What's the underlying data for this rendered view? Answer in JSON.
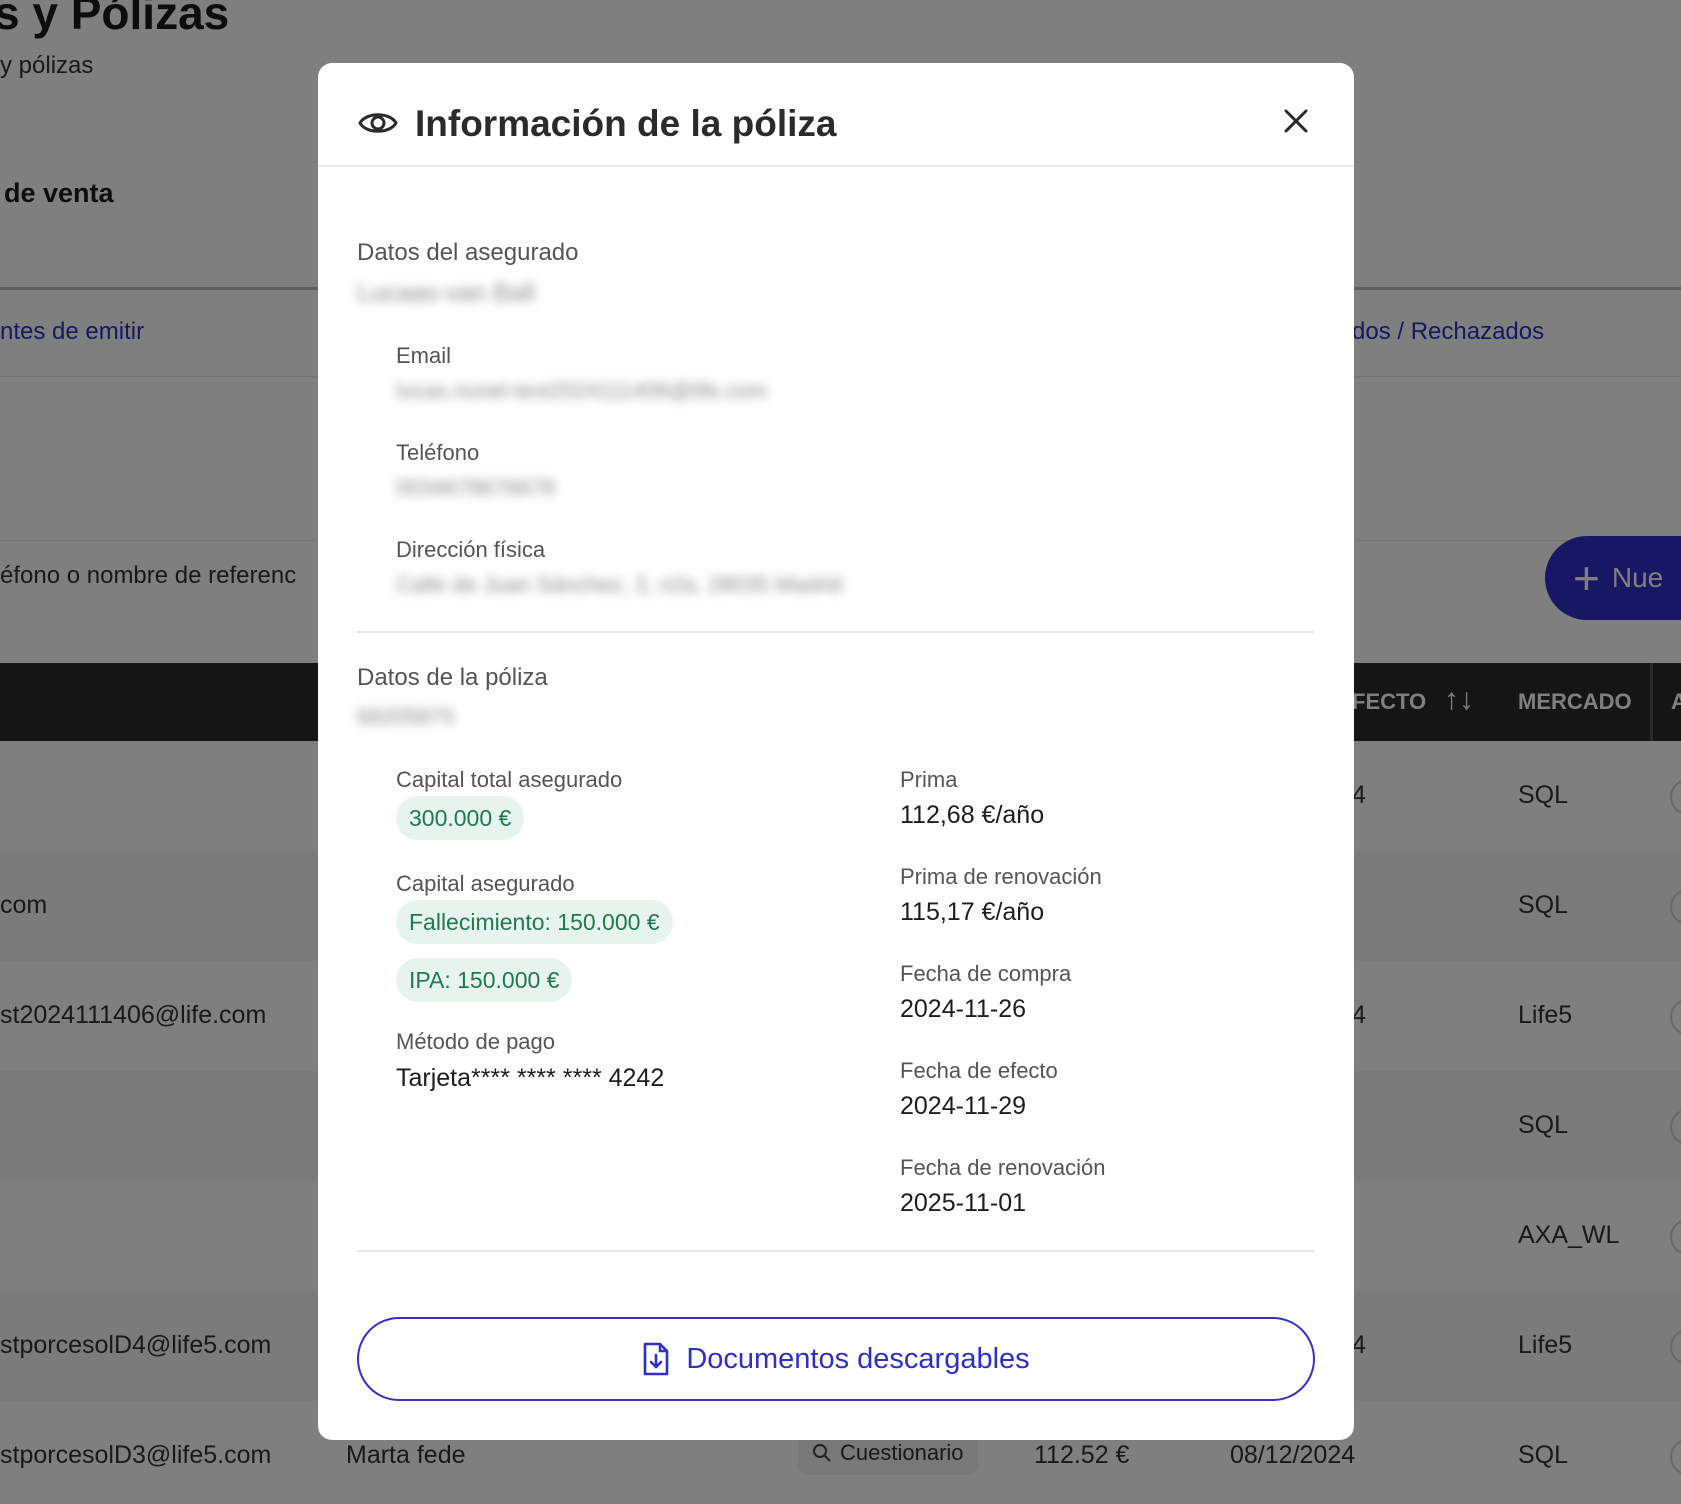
{
  "background": {
    "page_title": "s y Pólizas",
    "breadcrumb": "y pólizas",
    "section_title": "de venta",
    "tab_left": "ntes de emitir",
    "tab_right": "dos / Rechazados",
    "search_placeholder": "éfono o nombre de referenc",
    "new_button_label": "Nue",
    "table_headers": {
      "efecto": "FECTO",
      "sort_icon": "↑↓",
      "mercado": "MERCADO",
      "a": "A"
    },
    "rows": [
      {
        "email": "",
        "name": "",
        "status": "",
        "prima": "",
        "fecha": "",
        "fragment": "4",
        "mercado": "SQL"
      },
      {
        "email": "com",
        "name": "",
        "status": "",
        "prima": "",
        "fecha": "",
        "fragment": "",
        "mercado": "SQL"
      },
      {
        "email": "st2024111406@life.com",
        "name": "",
        "status": "",
        "prima": "",
        "fecha": "",
        "fragment": "4",
        "mercado": "Life5"
      },
      {
        "email": "",
        "name": "",
        "status": "",
        "prima": "",
        "fecha": "",
        "fragment": "",
        "mercado": "SQL"
      },
      {
        "email": "",
        "name": "",
        "status": "",
        "prima": "",
        "fecha": "",
        "fragment": "",
        "mercado": "AXA_WL"
      },
      {
        "email": "stporcesolD4@life5.com",
        "name": "",
        "status": "",
        "prima": "",
        "fecha": "",
        "fragment": "4",
        "mercado": "Life5"
      },
      {
        "email": "stporcesolD3@life5.com",
        "name": "Marta fede",
        "status": "Cuestionario",
        "prima": "112.52 €",
        "fecha": "08/12/2024",
        "fragment": "",
        "mercado": "SQL"
      }
    ]
  },
  "modal": {
    "title": "Información de la póliza",
    "icons": {
      "title": "eye-icon",
      "close": "close-icon",
      "docs": "download-document-icon"
    },
    "insured": {
      "section_title": "Datos del asegurado",
      "name_blurred": "Lucaas-van Ball",
      "email_label": "Email",
      "email_blurred": "lucas.nunel-test2024111406@life.com",
      "phone_label": "Teléfono",
      "phone_blurred": "0034678676678",
      "address_label": "Dirección física",
      "address_blurred": "Calle de Juan Sánchez, 3, n2a, 28035 Madrid"
    },
    "policy": {
      "section_title": "Datos de la póliza",
      "number_blurred": "68205875",
      "capital_total_label": "Capital total asegurado",
      "capital_total_value": "300.000 €",
      "capital_label": "Capital asegurado",
      "capital_fallecimiento": "Fallecimiento: 150.000 €",
      "capital_ipa": "IPA: 150.000 €",
      "payment_label": "Método de pago",
      "payment_value": "Tarjeta**** **** **** 4242",
      "prima_label": "Prima",
      "prima_value": "112,68 €/año",
      "prima_renovacion_label": "Prima de renovación",
      "prima_renovacion_value": "115,17 €/año",
      "fecha_compra_label": "Fecha de compra",
      "fecha_compra_value": "2024-11-26",
      "fecha_efecto_label": "Fecha de efecto",
      "fecha_efecto_value": "2024-11-29",
      "fecha_renovacion_label": "Fecha de renovación",
      "fecha_renovacion_value": "2025-11-01"
    },
    "docs_button": "Documentos descargables"
  },
  "colors": {
    "accent": "#2f2fc9",
    "pill_bg": "#e7f4ee",
    "pill_text": "#1f7a4d",
    "overlay": "rgba(0,0,0,0.5)"
  }
}
